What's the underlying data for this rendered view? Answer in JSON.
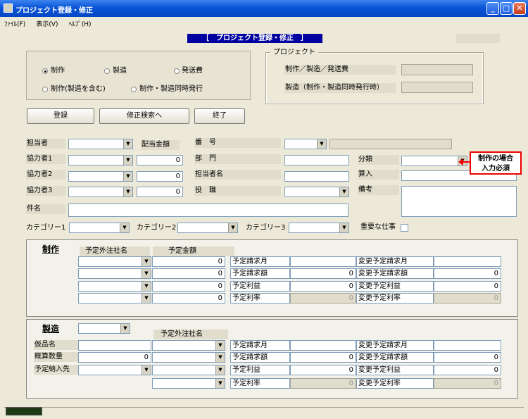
{
  "window": {
    "title": "プロジェクト登録・修正"
  },
  "menu": [
    "ﾌｧｲﾙ(F)",
    "表示(V)",
    "ﾍﾙﾌﾟ(H)"
  ],
  "header": {
    "title": "［　プロジェクト登録・修正　］"
  },
  "modes": {
    "seisaku": "制作",
    "seizou": "製造",
    "hassouhi": "発送費",
    "seisaku_incl": "制作(製造を含む)",
    "douji": "制作・製造同時発行"
  },
  "project_group": {
    "legend": "プロジェクト",
    "row1": "制作／製造／発送費",
    "row2": "製造（制作・製造同時発行時）"
  },
  "buttons": {
    "register": "登録",
    "search": "修正検索へ",
    "end": "終了"
  },
  "form": {
    "tantou": "担当者",
    "kyouryoku1": "協力者1",
    "kyouryoku2": "協力者2",
    "kyouryoku3": "協力者3",
    "haitou": "配当金額",
    "amount1": "0",
    "amount2": "0",
    "amount3": "0",
    "bangou": "番　号",
    "bumon": "部　門",
    "tantoumei": "担当者名",
    "yakushoku": "役　職",
    "bunrui": "分類",
    "sannyu": "算入",
    "bikou": "備考",
    "kenmei": "件名",
    "cat1": "カテゴリー1",
    "cat2": "カテゴリー2",
    "cat3": "カテゴリー3",
    "juuyou": "重要な仕事"
  },
  "note": {
    "line1": "制作の場合",
    "line2": "入力必須"
  },
  "seisaku_section": {
    "title": "制作",
    "col1": "予定外注社名",
    "col2": "予定金額",
    "amounts": [
      "0",
      "0",
      "0",
      "0"
    ]
  },
  "seizou_section": {
    "title": "製造",
    "col1": "予定外注社名",
    "kahinmei": "仮品名",
    "gaisan": "概算数量",
    "gaisan_value": "0",
    "nounyu": "予定納入先"
  },
  "summary": {
    "seikyu_month": "予定請求月",
    "seikyu_gaku": "予定請求額",
    "rieki": "予定利益",
    "riritsu": "予定利率",
    "h_seikyu_month": "変更予定請求月",
    "h_seikyu_gaku": "変更予定請求額",
    "h_rieki": "変更予定利益",
    "h_riritsu": "変更予定利率",
    "zero": "0"
  }
}
